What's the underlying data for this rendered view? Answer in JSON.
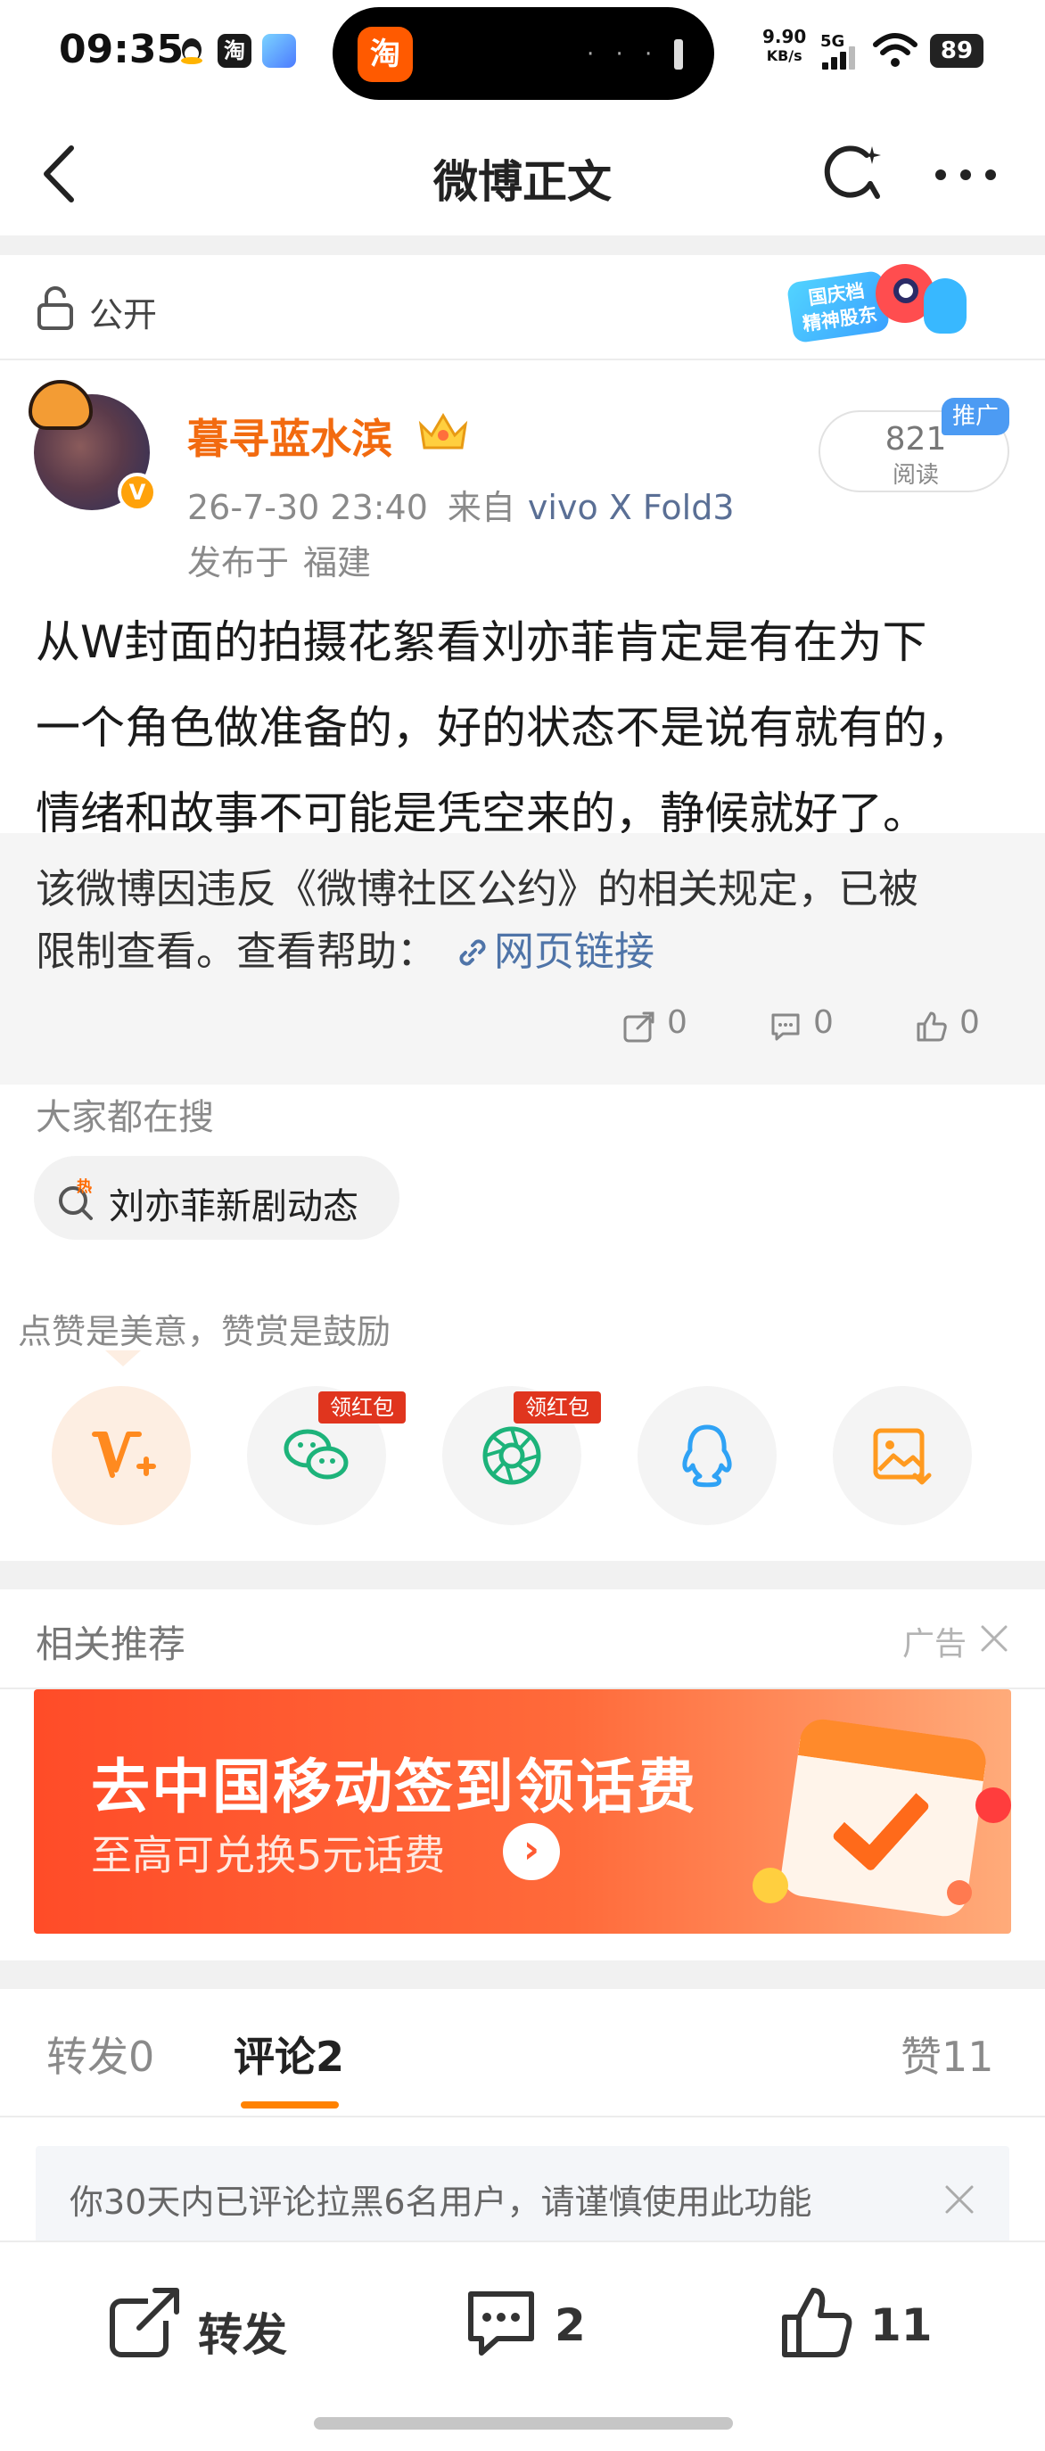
{
  "status_bar": {
    "time": "09:35",
    "island_app": "淘",
    "speed_value": "9.90",
    "speed_unit": "KB/s",
    "network": "5G",
    "battery": "89",
    "icons": [
      "qq-icon",
      "taobao-icon",
      "app-icon",
      "signal-icon",
      "wifi-icon",
      "battery-icon"
    ]
  },
  "nav": {
    "title": "微博正文",
    "icons": [
      "back-icon",
      "refresh-icon",
      "more-icon"
    ]
  },
  "visibility": {
    "label": "公开",
    "sticker_text": "国庆档\n精神股东"
  },
  "post": {
    "user_name": "暮寻蓝水滨",
    "time": "26-7-30 23:40",
    "source_label": "来自",
    "device": "vivo X Fold3",
    "location_label": "发布于",
    "location": "福建",
    "read_count": "821",
    "read_label": "阅读",
    "promo_badge": "推广",
    "verify_mark": "V",
    "body_lines": [
      "从W封面的拍摄花絮看刘亦菲肯定是有在为下",
      "一个角色做准备的，好的状态不是说有就有的，",
      "情绪和故事不可能是凭空来的，静候就好了。"
    ]
  },
  "restricted": {
    "line1": "该微博因违反《微博社区公约》的相关规定，已被",
    "line2_prefix": "限制查看。查看帮助：",
    "link_text": "网页链接",
    "repost_count": "0",
    "comment_count": "0",
    "like_count": "0"
  },
  "searches": {
    "header": "大家都在搜",
    "chip": "刘亦菲新剧动态",
    "hot_mark": "热"
  },
  "reward": {
    "header": "点赞是美意，赞赏是鼓励",
    "red_packet_tag": "领红包"
  },
  "related": {
    "header": "相关推荐",
    "ad_label": "广告",
    "banner_title": "去中国移动签到领话费",
    "banner_subtitle": "至高可兑换5元话费",
    "banner_go": "›"
  },
  "tabs": {
    "repost_label": "转发",
    "repost_count": "0",
    "comment_label": "评论",
    "comment_count": "2",
    "like_label": "赞",
    "like_count": "11"
  },
  "notice": {
    "text": "你30天内已评论拉黑6名用户，请谨慎使用此功能"
  },
  "bottom_bar": {
    "repost_label": "转发",
    "comment_count": "2",
    "like_count": "11"
  },
  "colors": {
    "accent_orange": "#ff8200",
    "username_orange": "#f26a0f",
    "link_blue": "#4f74a8",
    "red_tag": "#e0351e"
  }
}
